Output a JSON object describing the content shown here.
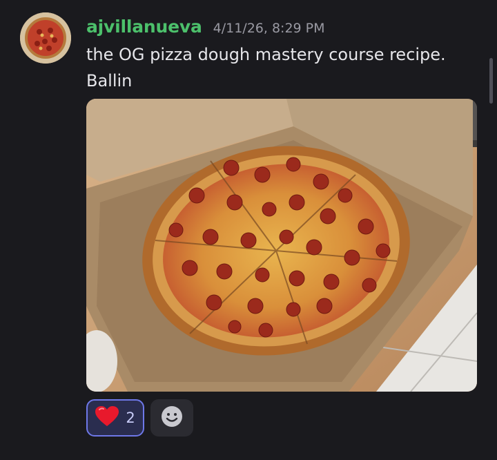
{
  "message": {
    "author": "ajvillanueva",
    "timestamp": "4/11/26, 8:29 PM",
    "content_lines": [
      "the OG pizza dough mastery course recipe.",
      "Ballin"
    ],
    "attachment": {
      "type": "image",
      "subject": "pepperoni pizza in cardboard box"
    },
    "author_color": "#4cc06b"
  },
  "reactions": [
    {
      "emoji": "❤️",
      "icon": "heart-icon",
      "count": "2",
      "active": true
    },
    {
      "icon": "add-reaction-icon",
      "active": false
    }
  ],
  "colors": {
    "background": "#1a1a1e",
    "reaction_active_border": "#6e78e8",
    "reaction_active_bg": "#2a2d4f"
  }
}
